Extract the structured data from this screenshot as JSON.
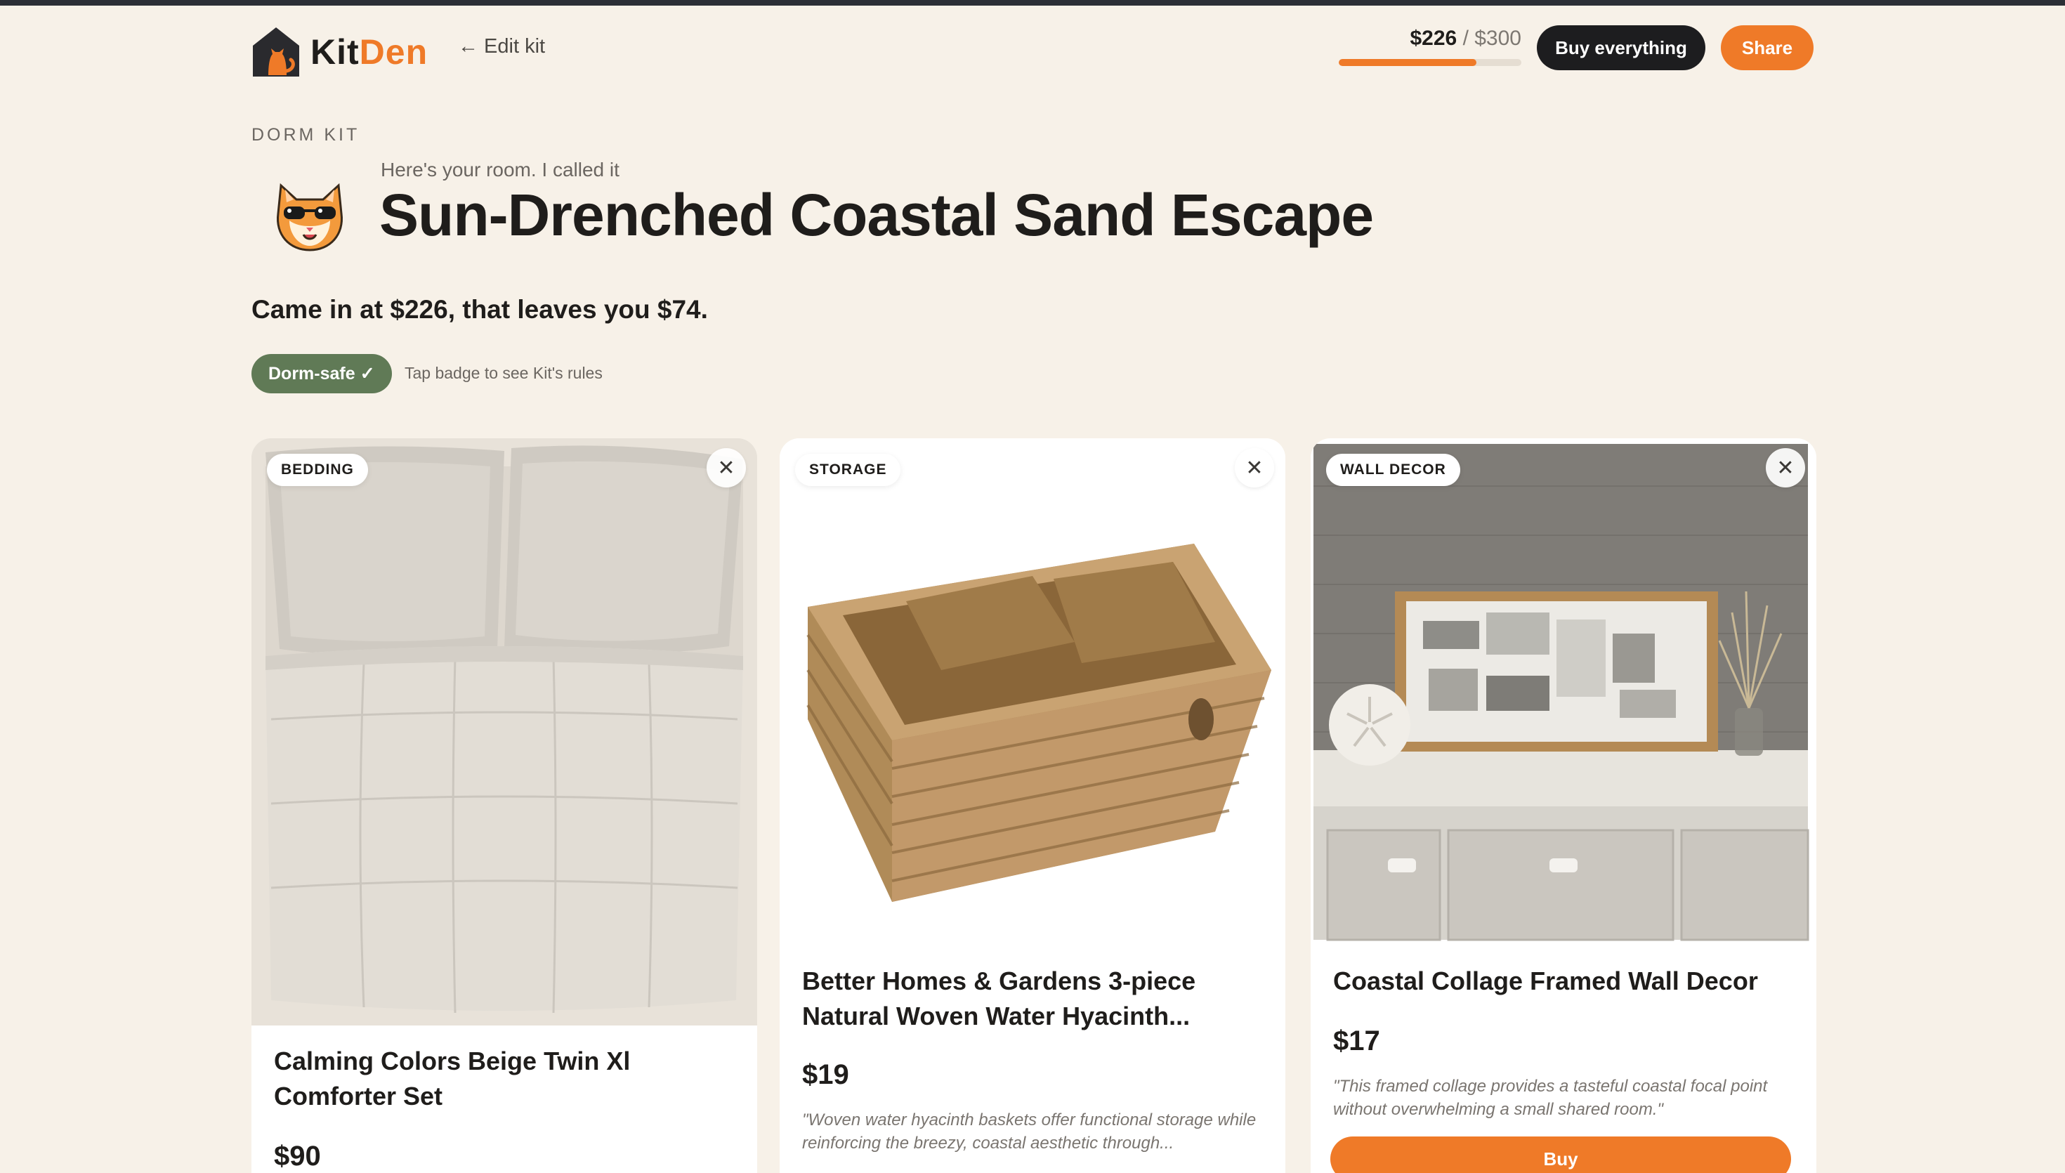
{
  "header": {
    "logo": {
      "kit": "Kit",
      "den": "Den"
    },
    "edit_kit": "← Edit kit",
    "budget": {
      "spent": "$226",
      "separator": " / ",
      "total": "$300",
      "fraction": 0.753
    },
    "buy_everything": "Buy everything",
    "share": "Share"
  },
  "hero": {
    "eyebrow": "DORM KIT",
    "subtitle": "Here's your room. I called it",
    "title": "Sun-Drenched Coastal Sand Escape",
    "summary": "Came in at $226, that leaves you $74.",
    "badge": "Dorm-safe ✓",
    "badge_hint": "Tap badge to see Kit's rules"
  },
  "cards": [
    {
      "category": "BEDDING",
      "title": "Calming Colors Beige Twin Xl Comforter Set",
      "price": "$90",
      "quote": ""
    },
    {
      "category": "STORAGE",
      "title": "Better Homes & Gardens 3-piece Natural Woven Water Hyacinth...",
      "price": "$19",
      "quote": "\"Woven water hyacinth baskets offer functional storage while reinforcing the breezy, coastal aesthetic through..."
    },
    {
      "category": "WALL DECOR",
      "title": "Coastal Collage Framed Wall Decor",
      "price": "$17",
      "quote": "\"This framed collage provides a tasteful coastal focal point without overwhelming a small shared room.\"",
      "buy": "Buy"
    }
  ],
  "icons": {
    "close": "close-icon",
    "logo": "house-cat-logo-icon",
    "mascot": "cat-sunglasses-mascot"
  },
  "colors": {
    "accent": "#ef7a28",
    "dark": "#1d1d1f",
    "badge": "#607a56",
    "background": "#f7f1e8"
  }
}
